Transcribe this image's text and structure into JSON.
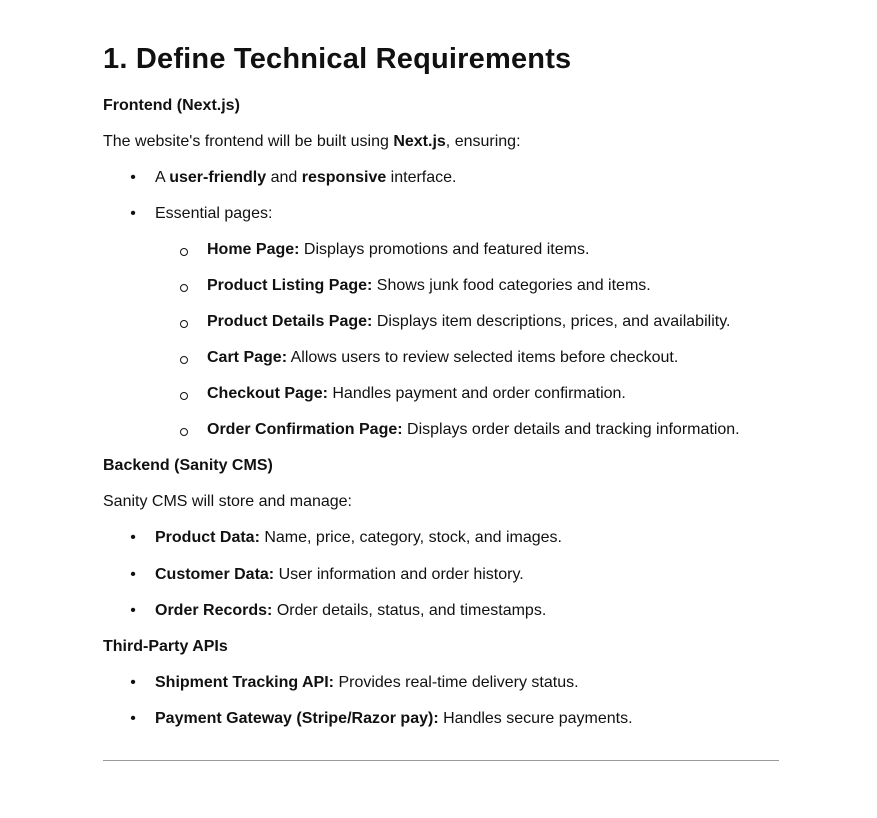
{
  "document": {
    "heading": "1. Define Technical Requirements",
    "frontend": {
      "title": "Frontend (Next.js)",
      "intro_prefix": "The website's frontend will be built using ",
      "intro_bold": "Next.js",
      "intro_suffix": ", ensuring:",
      "bullets": {
        "item1": {
          "prefix": "A ",
          "bold1": "user-friendly",
          "mid": " and ",
          "bold2": "responsive",
          "suffix": " interface."
        },
        "item2": "Essential pages:"
      },
      "pages": [
        {
          "name": "Home Page:",
          "desc": " Displays promotions and featured items."
        },
        {
          "name": "Product Listing Page:",
          "desc": " Shows junk food categories and items."
        },
        {
          "name": "Product Details Page:",
          "desc": " Displays item descriptions, prices, and availability."
        },
        {
          "name": "Cart Page:",
          "desc": " Allows users to review selected items before checkout."
        },
        {
          "name": "Checkout Page:",
          "desc": " Handles payment and order confirmation."
        },
        {
          "name": "Order Confirmation Page:",
          "desc": " Displays order details and tracking information."
        }
      ]
    },
    "backend": {
      "title": "Backend (Sanity CMS)",
      "intro": "Sanity CMS will store and manage:",
      "items": [
        {
          "name": "Product Data:",
          "desc": " Name, price, category, stock, and images."
        },
        {
          "name": "Customer Data:",
          "desc": " User information and order history."
        },
        {
          "name": "Order Records:",
          "desc": " Order details, status, and timestamps."
        }
      ]
    },
    "apis": {
      "title": "Third-Party APIs",
      "items": [
        {
          "name": "Shipment Tracking API:",
          "desc": " Provides real-time delivery status."
        },
        {
          "name": "Payment Gateway (Stripe/Razor pay):",
          "desc": " Handles secure payments."
        }
      ]
    }
  }
}
